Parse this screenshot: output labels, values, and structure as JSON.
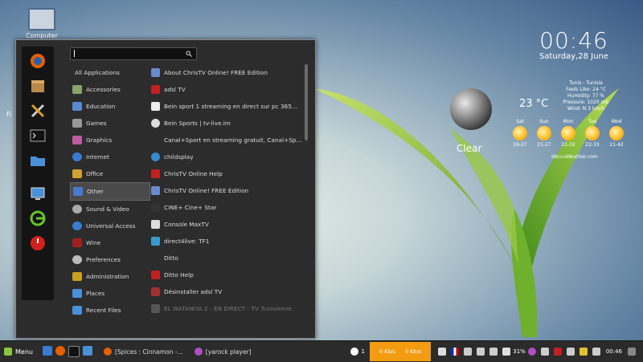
{
  "desktop": {
    "computer_label": "Computer",
    "partial_label": "Fi"
  },
  "clock": {
    "time": "00:46",
    "date": "Saturday,28 June"
  },
  "weather": {
    "condition": "Clear",
    "temperature": "23 °C",
    "location": "Tunis - Tunisia",
    "feels_like": "Feels Like: 24 °C",
    "humidity": "Humidity: 77 %",
    "pressure": "Pressure: 1020 mb",
    "wind": "Wind: N 3 km/h",
    "days": [
      {
        "name": "Sat",
        "range": "19-27"
      },
      {
        "name": "Sun",
        "range": "21-27"
      },
      {
        "name": "Mon",
        "range": "21-32"
      },
      {
        "name": "Tue",
        "range": "22-33"
      },
      {
        "name": "Wed",
        "range": "21-42"
      }
    ],
    "source": "dAccuWeather.com"
  },
  "menu": {
    "categories": [
      "All Applications",
      "Accessories",
      "Education",
      "Games",
      "Graphics",
      "Internet",
      "Office",
      "Other",
      "Sound & Video",
      "Universal Access",
      "Wine",
      "Preferences",
      "Administration",
      "Places",
      "Recent Files"
    ],
    "apps": [
      "About ChrisTV Online! FREE Edition",
      "adsl TV",
      "Bein sport 1 streaming en direct sur pc 365...",
      "Bein Sports | tv-live.im",
      "Canal+Sport en streaming gratuit, Canal+Sp...",
      "childsplay",
      "ChrisTV Online Help",
      "ChrisTV Online! FREE Edition",
      "CINE+ Cine+ Star",
      "Console MaxTV",
      "direct4live: TF1",
      "Ditto",
      "Ditto Help",
      "Désinstaller adsl TV",
      "EL WATANIYA 2 - EN DIRECT - TV Tunisienne"
    ]
  },
  "taskbar": {
    "menu_label": "Menu",
    "windows": [
      "[Spices : Cinnamon -...",
      "[yarock player]"
    ],
    "notif_count": "1",
    "net_down": "0 Kb/s",
    "net_up": "0 Kb/s",
    "battery": "31%",
    "time": "00:46"
  }
}
